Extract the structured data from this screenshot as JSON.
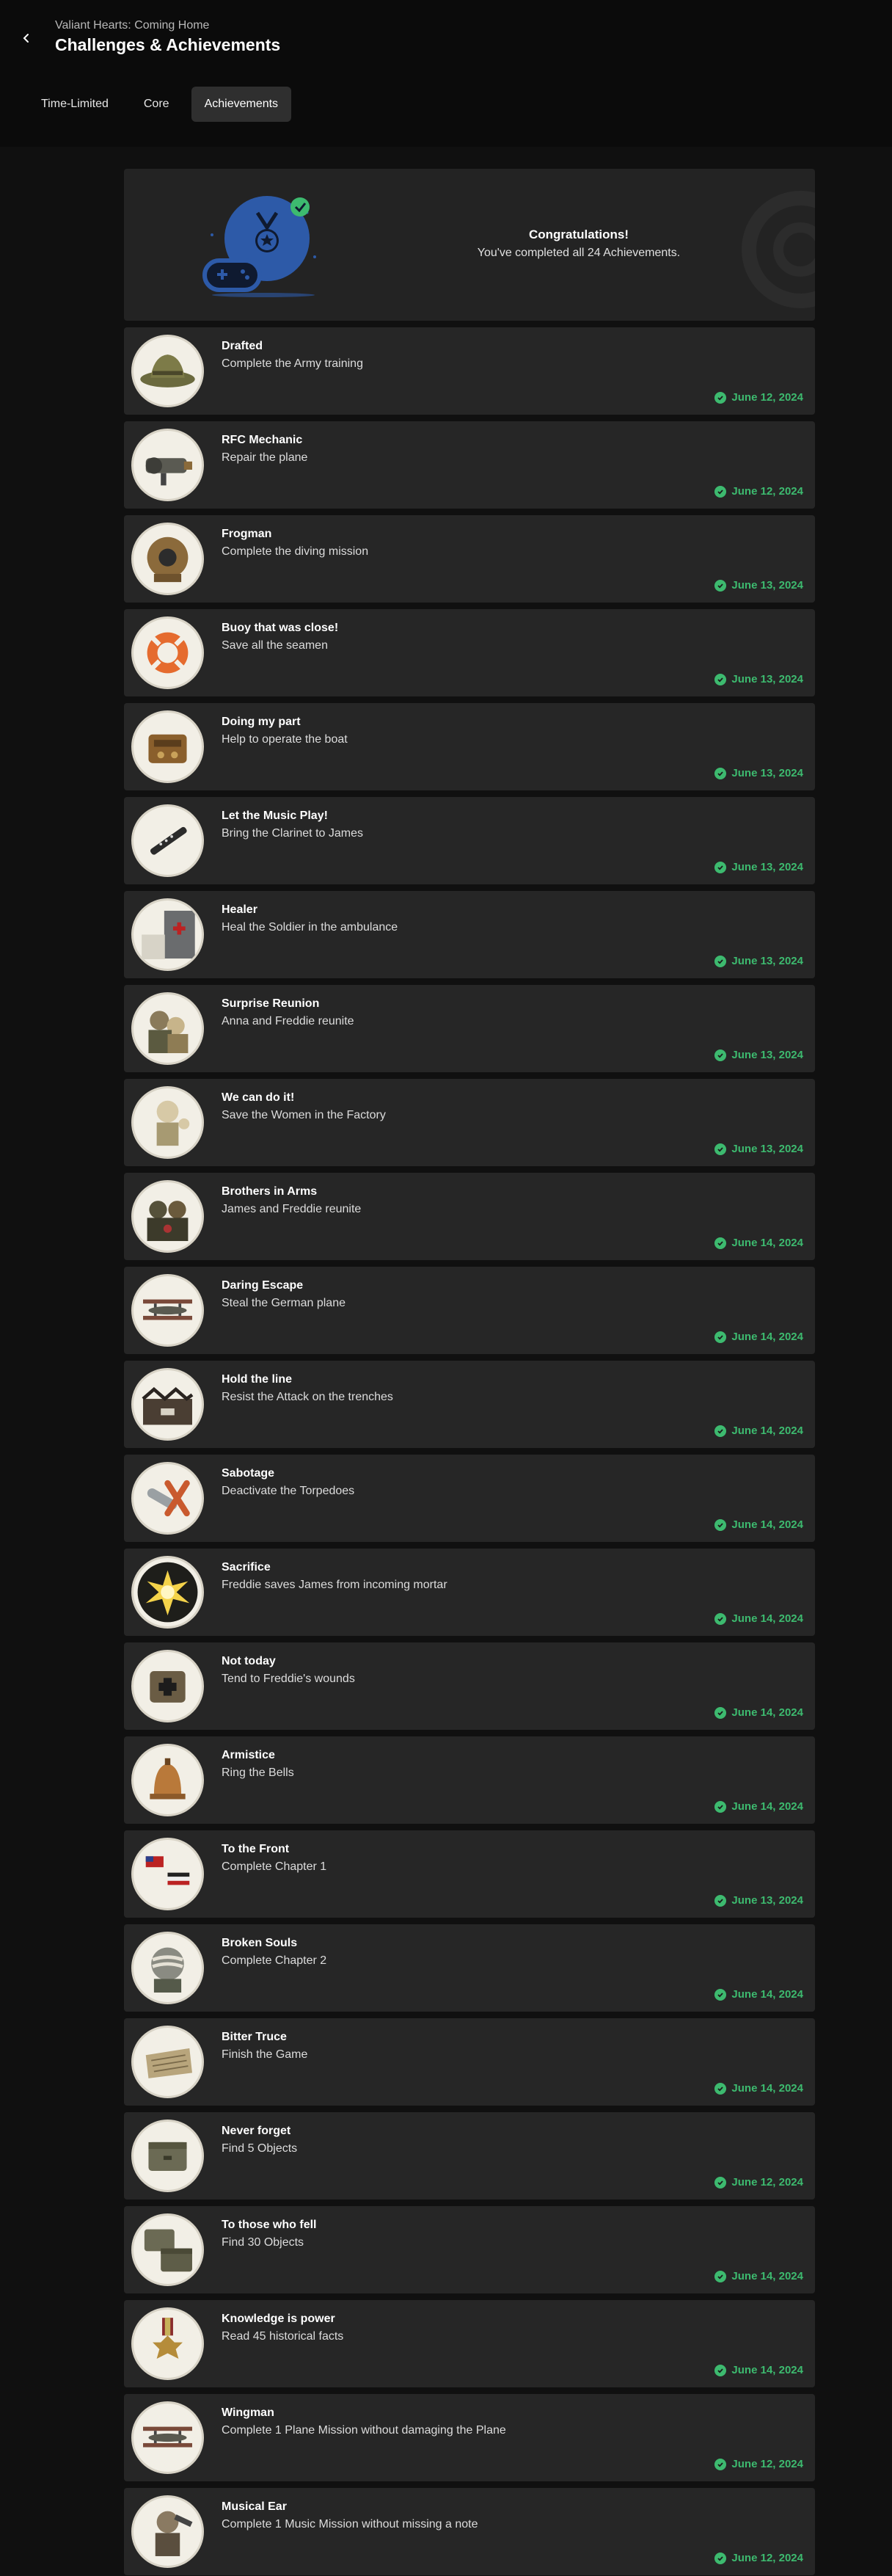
{
  "header": {
    "game_title": "Valiant Hearts: Coming Home",
    "page_title": "Challenges & Achievements"
  },
  "tabs": [
    {
      "label": "Time-Limited",
      "active": false
    },
    {
      "label": "Core",
      "active": false
    },
    {
      "label": "Achievements",
      "active": true
    }
  ],
  "banner": {
    "title": "Congratulations!",
    "subtitle": "You've completed all 24 Achievements."
  },
  "colors": {
    "background": "#101010",
    "card": "#262626",
    "accent_green": "#3dba6f",
    "medal_blue": "#2d5aa8"
  },
  "achievements": [
    {
      "name": "Drafted",
      "description": "Complete the Army training",
      "date": "June 12, 2024",
      "icon": "army-hat-icon"
    },
    {
      "name": "RFC Mechanic",
      "description": "Repair the plane",
      "date": "June 12, 2024",
      "icon": "plane-engine-icon"
    },
    {
      "name": "Frogman",
      "description": "Complete the diving mission",
      "date": "June 13, 2024",
      "icon": "diving-helmet-icon"
    },
    {
      "name": "Buoy that was close!",
      "description": "Save all the seamen",
      "date": "June 13, 2024",
      "icon": "lifebuoy-icon"
    },
    {
      "name": "Doing my part",
      "description": "Help to operate the boat",
      "date": "June 13, 2024",
      "icon": "boat-engine-icon"
    },
    {
      "name": "Let the Music Play!",
      "description": "Bring the Clarinet to James",
      "date": "June 13, 2024",
      "icon": "clarinet-icon"
    },
    {
      "name": "Healer",
      "description": "Heal the Soldier in the ambulance",
      "date": "June 13, 2024",
      "icon": "ambulance-icon"
    },
    {
      "name": "Surprise Reunion",
      "description": "Anna and Freddie reunite",
      "date": "June 13, 2024",
      "icon": "reunion-icon"
    },
    {
      "name": "We can do it!",
      "description": "Save the Women in the Factory",
      "date": "June 13, 2024",
      "icon": "factory-worker-icon"
    },
    {
      "name": "Brothers in Arms",
      "description": "James and Freddie reunite",
      "date": "June 14, 2024",
      "icon": "soldiers-icon"
    },
    {
      "name": "Daring Escape",
      "description": "Steal the German plane",
      "date": "June 14, 2024",
      "icon": "biplane-icon"
    },
    {
      "name": "Hold the line",
      "description": "Resist the Attack on the trenches",
      "date": "June 14, 2024",
      "icon": "trench-icon"
    },
    {
      "name": "Sabotage",
      "description": "Deactivate the Torpedoes",
      "date": "June 14, 2024",
      "icon": "torpedo-icon"
    },
    {
      "name": "Sacrifice",
      "description": "Freddie saves James from incoming mortar",
      "date": "June 14, 2024",
      "icon": "explosion-icon"
    },
    {
      "name": "Not today",
      "description": "Tend to Freddie's wounds",
      "date": "June 14, 2024",
      "icon": "medkit-icon"
    },
    {
      "name": "Armistice",
      "description": "Ring the Bells",
      "date": "June 14, 2024",
      "icon": "bell-icon"
    },
    {
      "name": "To the Front",
      "description": "Complete Chapter 1",
      "date": "June 13, 2024",
      "icon": "flags-icon"
    },
    {
      "name": "Broken Souls",
      "description": "Complete Chapter 2",
      "date": "June 14, 2024",
      "icon": "bandaged-soldier-icon"
    },
    {
      "name": "Bitter Truce",
      "description": "Finish the Game",
      "date": "June 14, 2024",
      "icon": "letter-icon"
    },
    {
      "name": "Never forget",
      "description": "Find 5 Objects",
      "date": "June 12, 2024",
      "icon": "crate-icon"
    },
    {
      "name": "To those who fell",
      "description": "Find 30 Objects",
      "date": "June 14, 2024",
      "icon": "crates-icon"
    },
    {
      "name": "Knowledge is power",
      "description": "Read 45 historical facts",
      "date": "June 14, 2024",
      "icon": "medal-cross-icon"
    },
    {
      "name": "Wingman",
      "description": "Complete 1 Plane Mission without damaging the Plane",
      "date": "June 12, 2024",
      "icon": "biplane-icon"
    },
    {
      "name": "Musical Ear",
      "description": "Complete 1 Music Mission without missing a note",
      "date": "June 12, 2024",
      "icon": "musician-icon"
    }
  ]
}
